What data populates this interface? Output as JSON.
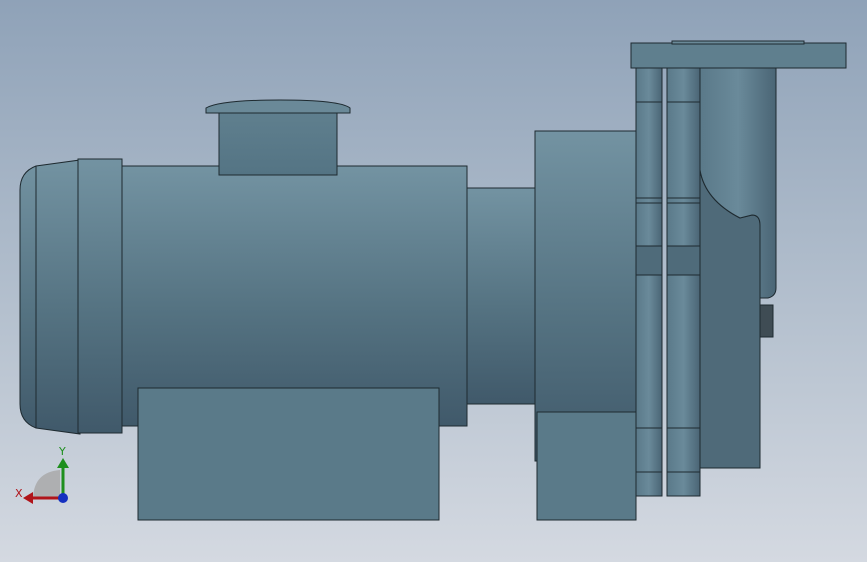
{
  "viewport": {
    "background_top": "#8fa2b8",
    "background_bottom": "#d4d9e1"
  },
  "model": {
    "body_color": "#5b7a8a",
    "body_light": "#7192a2",
    "body_dark": "#3f5766",
    "edge_color": "#1e2a30"
  },
  "triad": {
    "x_label": "X",
    "y_label": "Y",
    "x_color": "#b0141a",
    "y_color": "#1e8f1e",
    "z_color": "#1530c0"
  }
}
